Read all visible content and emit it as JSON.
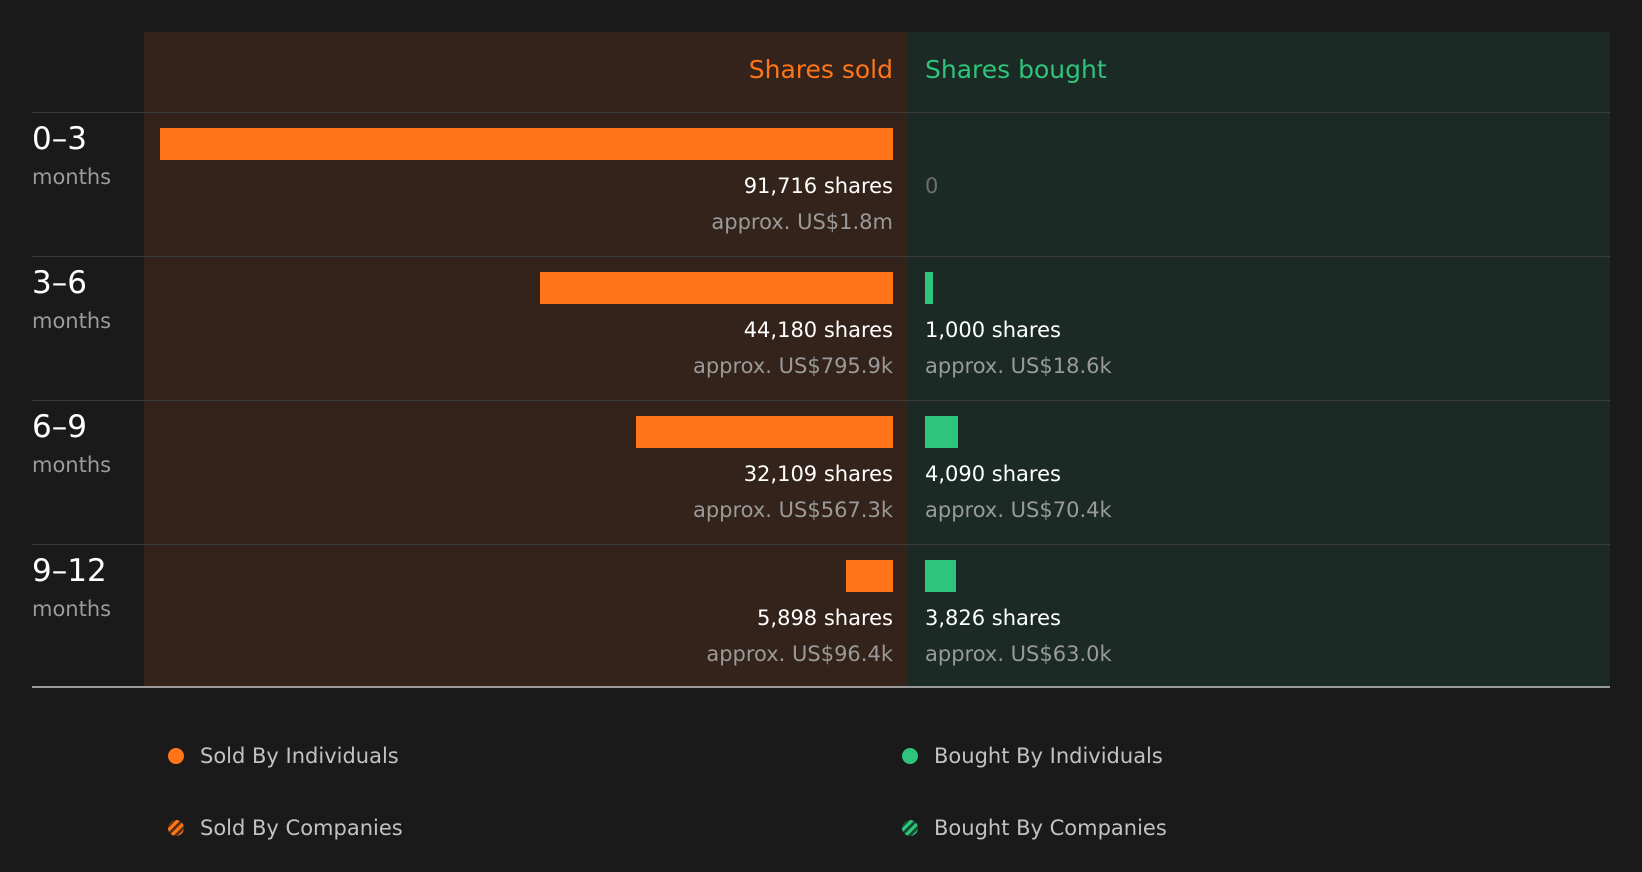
{
  "colors": {
    "sold": "#ff7518",
    "bought": "#2ec47b"
  },
  "chart_data": {
    "type": "bar",
    "headers": {
      "sold": "Shares sold",
      "bought": "Shares bought"
    },
    "unit": "months",
    "categories": [
      "0–3",
      "3–6",
      "6–9",
      "9–12"
    ],
    "series": [
      {
        "name": "Shares sold",
        "values": [
          91716,
          44180,
          32109,
          5898
        ],
        "labels": [
          "91,716 shares",
          "44,180 shares",
          "32,109 shares",
          "5,898 shares"
        ],
        "approx": [
          "approx. US$1.8m",
          "approx. US$795.9k",
          "approx. US$567.3k",
          "approx. US$96.4k"
        ]
      },
      {
        "name": "Shares bought",
        "values": [
          0,
          1000,
          4090,
          3826
        ],
        "labels": [
          "0",
          "1,000 shares",
          "4,090 shares",
          "3,826 shares"
        ],
        "approx": [
          "",
          "approx. US$18.6k",
          "approx. US$70.4k",
          "approx. US$63.0k"
        ]
      }
    ],
    "legend": [
      {
        "label": "Sold By Individuals",
        "icon": "filled-circle-icon",
        "color": "#ff7518"
      },
      {
        "label": "Bought By Individuals",
        "icon": "filled-circle-icon",
        "color": "#2ec47b"
      },
      {
        "label": "Sold By Companies",
        "icon": "hatched-circle-icon",
        "color": "#ff7518"
      },
      {
        "label": "Bought By Companies",
        "icon": "hatched-circle-icon",
        "color": "#2ec47b"
      }
    ]
  }
}
